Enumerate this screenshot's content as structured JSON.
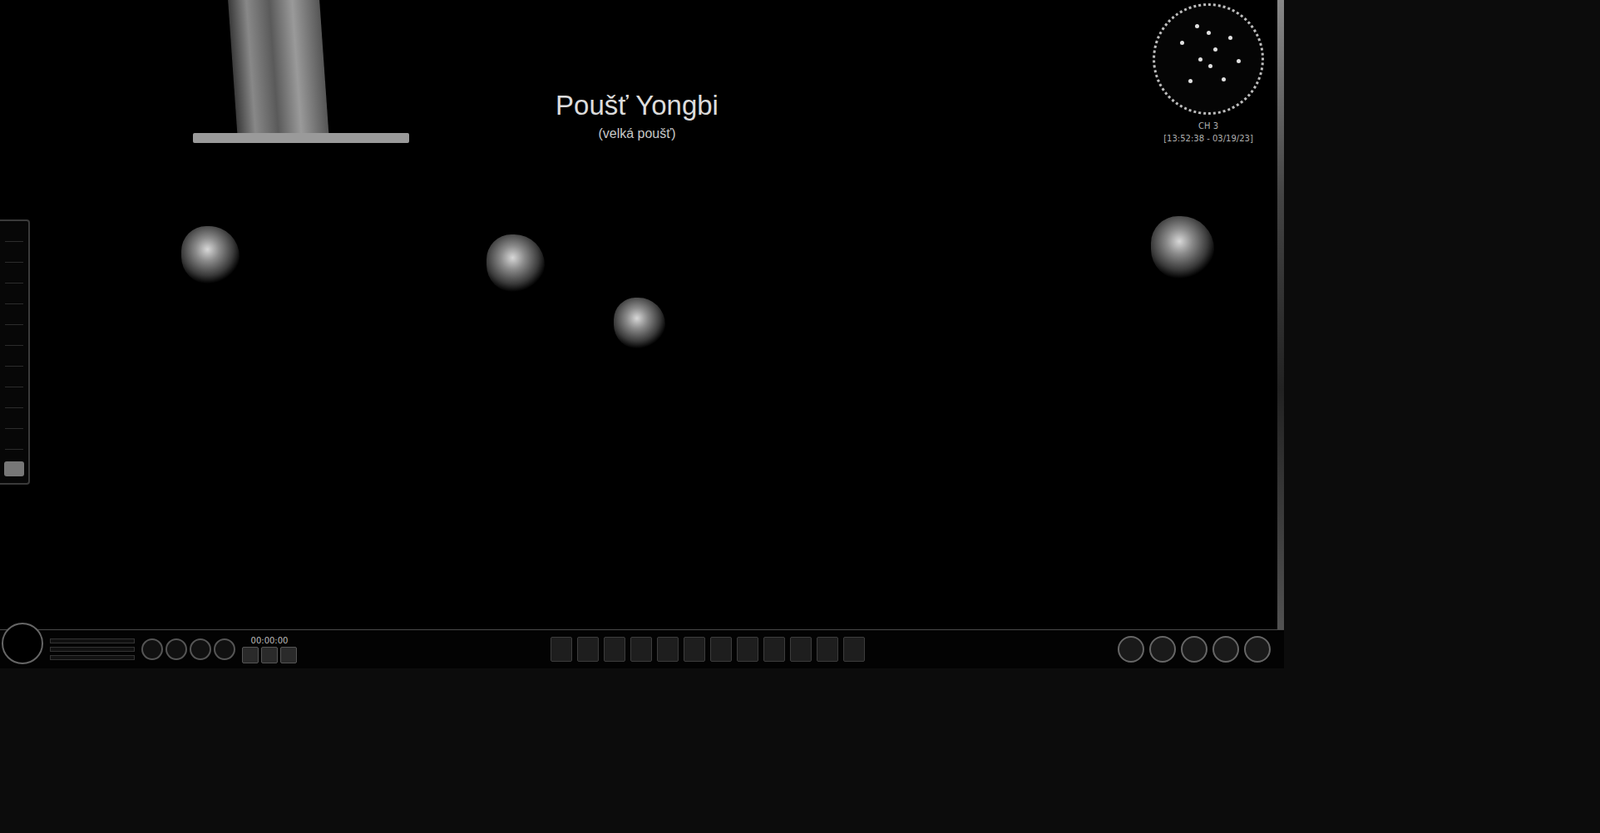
{
  "location": {
    "title": "Poušť Yongbi",
    "subtitle": "(velká poušť)"
  },
  "minimap": {
    "channel": "CH 3",
    "clock": "[13:52:38 - 03/19/23]"
  },
  "status_bar": {
    "timer": "00:00:00"
  }
}
